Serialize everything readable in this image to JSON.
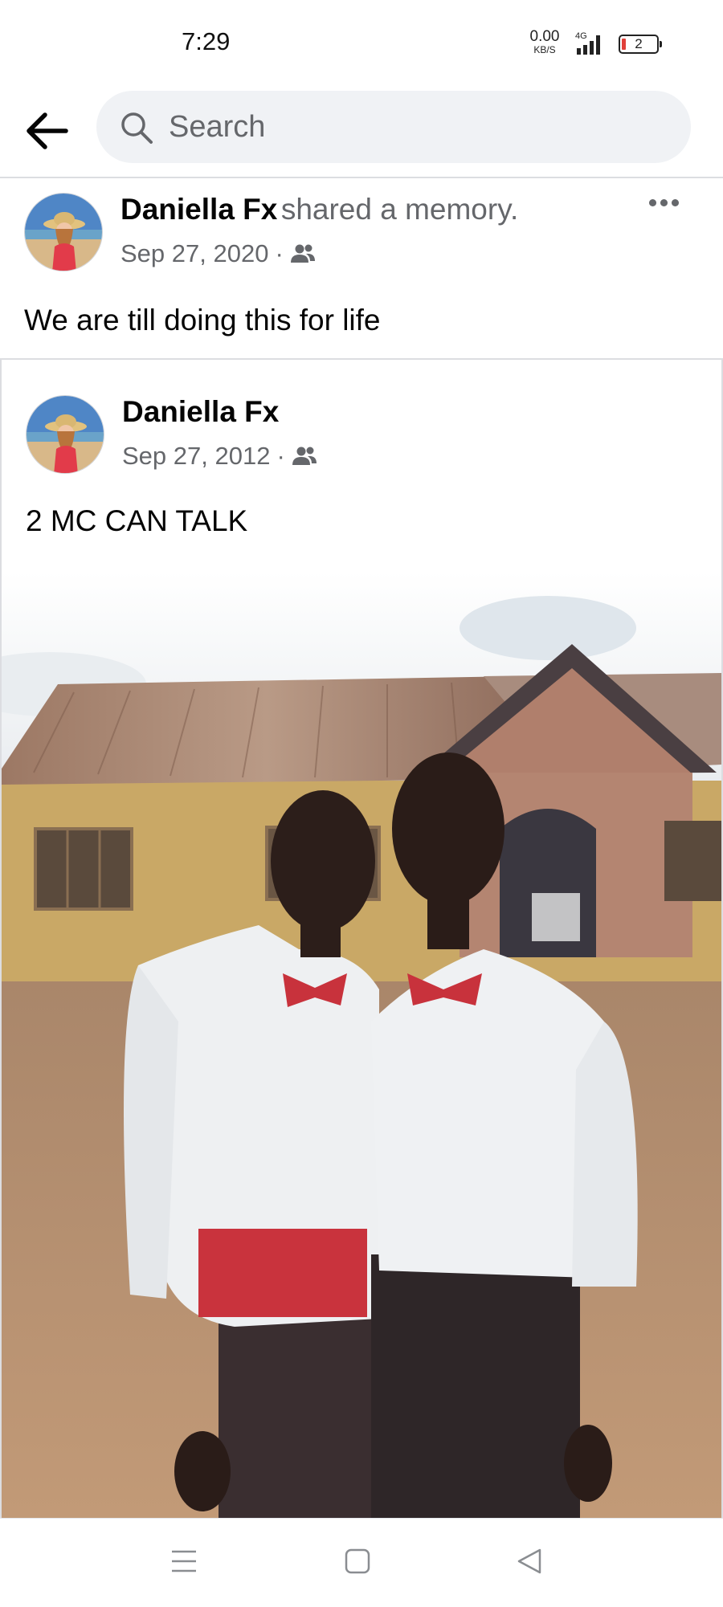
{
  "status_bar": {
    "time": "7:29",
    "net_speed_value": "0.00",
    "net_speed_unit": "KB/S",
    "network_type": "4G",
    "battery_level": "2"
  },
  "search": {
    "placeholder": "Search"
  },
  "memory_post": {
    "author": "Daniella Fx",
    "action": "shared a memory.",
    "date": "Sep 27, 2020",
    "separator": "·",
    "audience_icon": "friends-icon",
    "text": "We are till doing this for life"
  },
  "original_post": {
    "author": "Daniella Fx",
    "date": "Sep 27, 2012",
    "separator": "·",
    "audience_icon": "friends-icon",
    "text": "2 MC CAN TALK"
  },
  "nav": {
    "icons": [
      "menu-icon",
      "home-square-icon",
      "back-triangle-icon"
    ]
  },
  "colors": {
    "text_primary": "#050505",
    "text_secondary": "#65676b",
    "search_bg": "#f0f2f5",
    "divider": "#dcdde1"
  }
}
